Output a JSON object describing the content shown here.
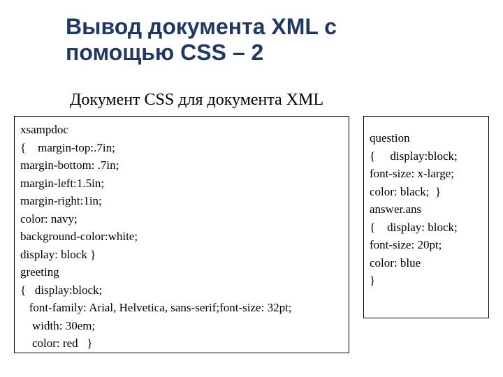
{
  "title": "Вывод документа XML с\nпомощью CSS – 2",
  "subtitle": "Документ CSS для документа XML",
  "leftCode": "xsampdoc\n{    margin-top:.7in;\nmargin-bottom: .7in;\nmargin-left:1.5in;\nmargin-right:1in;\ncolor: navy;\nbackground-color:white;\ndisplay: block }\ngreeting\n{   display:block;\n   font-family: Arial, Helvetica, sans-serif;font-size: 32pt;\n    width: 30em;\n    color: red   }",
  "rightCode": "question\n{     display:block;\nfont-size: x-large;\ncolor: black;  }\nanswer.ans\n{    display: block;\nfont-size: 20pt;\ncolor: blue\n}"
}
